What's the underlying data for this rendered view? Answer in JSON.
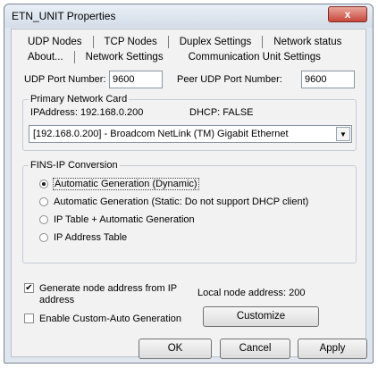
{
  "window": {
    "title": "ETN_UNIT Properties",
    "close_label": "x"
  },
  "tabs": {
    "row1": [
      "UDP Nodes",
      "TCP Nodes",
      "Duplex Settings",
      "Network status"
    ],
    "row2": [
      "About...",
      "Network Settings",
      "Communication Unit Settings"
    ],
    "active": "Network Settings"
  },
  "udp": {
    "port_label": "UDP Port Number:",
    "port_value": "9600",
    "peer_label": "Peer UDP Port Number:",
    "peer_value": "9600"
  },
  "primary_card": {
    "label": "Primary Network Card",
    "ip_text": "IPAddress: 192.168.0.200",
    "dhcp_text": "DHCP: FALSE",
    "selected_adapter": "[192.168.0.200] - Broadcom NetLink (TM) Gigabit Ethernet"
  },
  "fins": {
    "label": "FINS-IP Conversion",
    "options": [
      "Automatic Generation (Dynamic)",
      "Automatic Generation (Static: Do not support DHCP client)",
      "IP Table + Automatic Generation",
      "IP Address Table"
    ],
    "selected_index": 0
  },
  "options": {
    "generate_node_label": "Generate node address from IP address",
    "generate_node_checked": true,
    "local_node_text": "Local node address: 200",
    "custom_auto_label": "Enable Custom-Auto Generation",
    "custom_auto_checked": false,
    "customize_label": "Customize"
  },
  "footer": {
    "ok": "OK",
    "cancel": "Cancel",
    "apply": "Apply"
  }
}
